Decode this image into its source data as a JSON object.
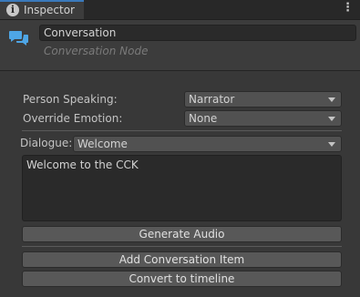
{
  "tab": {
    "title": "Inspector",
    "info_icon": "info-icon",
    "menu_icon": "kebab-menu-icon"
  },
  "header": {
    "icon": "chat-bubbles-icon",
    "name_value": "Conversation",
    "subtitle": "Conversation Node"
  },
  "fields": {
    "person_speaking_label": "Person Speaking:",
    "person_speaking_value": "Narrator",
    "override_emotion_label": "Override Emotion:",
    "override_emotion_value": "None",
    "dialogue_label": "Dialogue:",
    "dialogue_value": "Welcome",
    "dialogue_text": "Welcome to the CCK"
  },
  "buttons": {
    "generate_audio": "Generate Audio",
    "add_conversation_item": "Add Conversation Item",
    "convert_to_timeline": "Convert to timeline"
  },
  "colors": {
    "accent": "#3a79bb",
    "background": "#383838",
    "icon_blue": "#4ea6e6"
  }
}
